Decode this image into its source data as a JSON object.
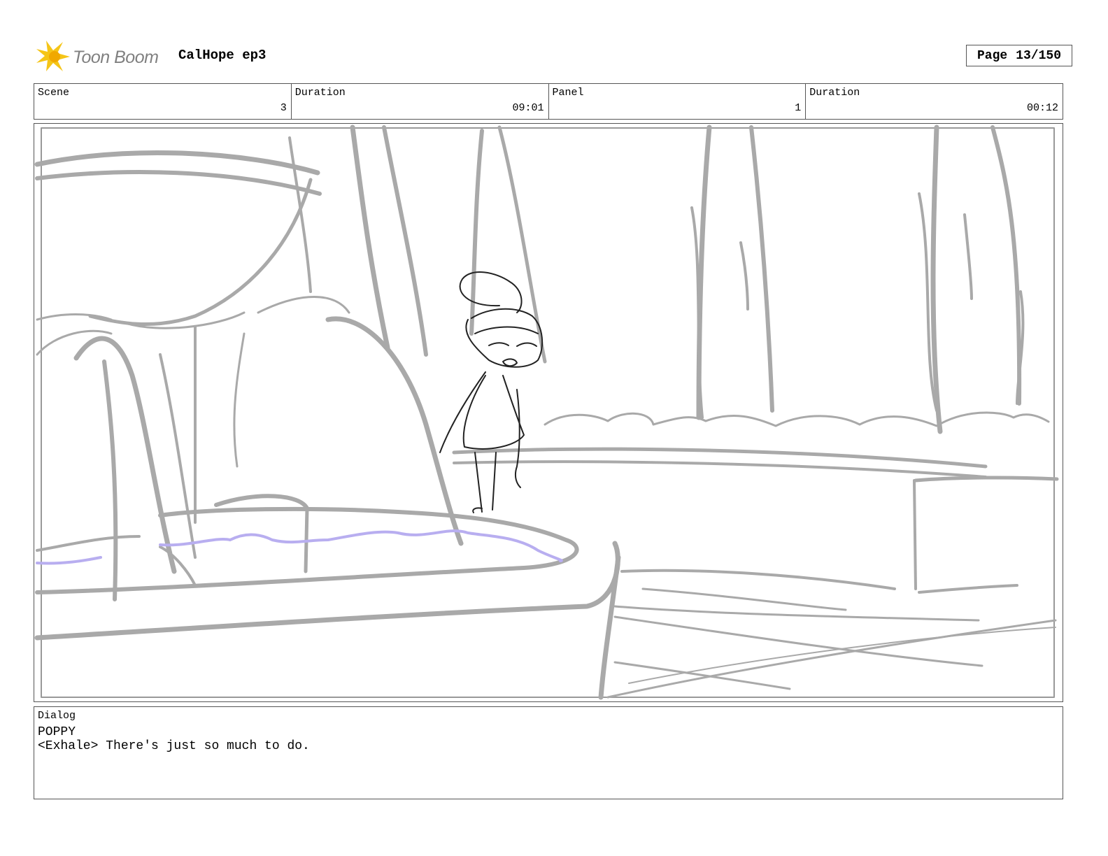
{
  "header": {
    "logo_text": "Toon Boom",
    "project_title": "CalHope ep3",
    "page_label": "Page",
    "page_number": "13/150"
  },
  "info": {
    "scene_label": "Scene",
    "scene_value": "3",
    "scene_duration_label": "Duration",
    "scene_duration_value": "09:01",
    "panel_label": "Panel",
    "panel_value": "1",
    "panel_duration_label": "Duration",
    "panel_duration_value": "00:12"
  },
  "dialog": {
    "label": "Dialog",
    "speaker": "POPPY",
    "line": "<Exhale> There's just so much to do."
  },
  "colors": {
    "sketch_gray": "#a9a9a9",
    "water_lavender": "#b8aef0",
    "logo_yellow": "#f5c518",
    "border": "#555555"
  }
}
